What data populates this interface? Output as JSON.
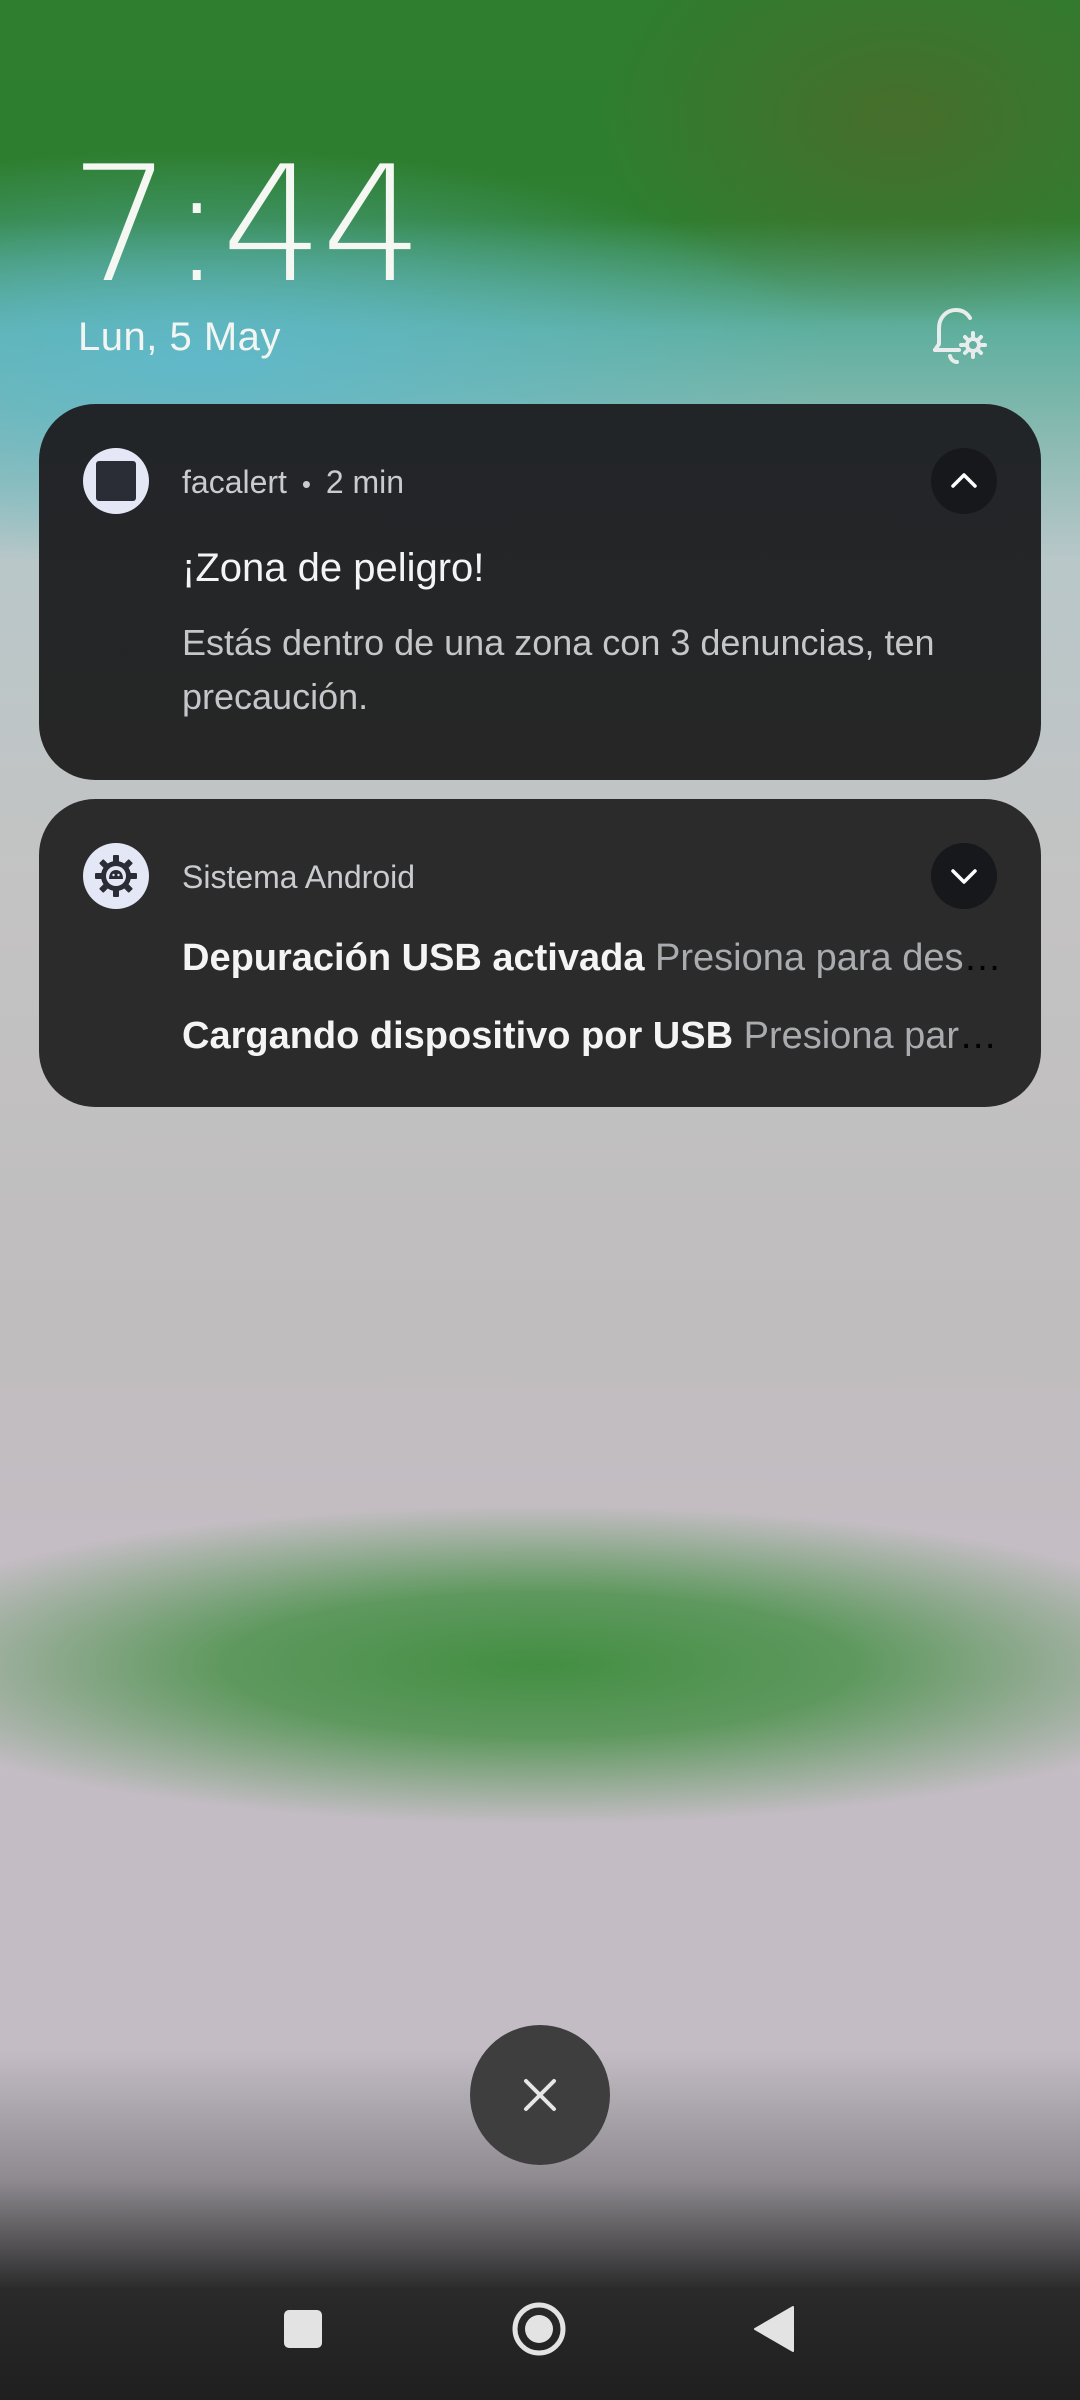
{
  "lockscreen": {
    "time": "7:44",
    "date": "Lun, 5 May"
  },
  "notifications": [
    {
      "app": "facalert",
      "separator": "•",
      "age": "2 min",
      "title": "¡Zona de peligro!",
      "body": "Estás dentro de una zona con 3 denuncias, ten precaución.",
      "expanded": true,
      "icon": "square-app-icon"
    },
    {
      "app": "Sistema Android",
      "expanded": false,
      "icon": "android-system-gear-icon",
      "rows": [
        {
          "title": "Depuración USB activada",
          "text": "Presiona para desactivar la depuración USB"
        },
        {
          "title": "Cargando dispositivo por USB",
          "text": "Presiona para ver más opciones"
        }
      ]
    }
  ],
  "icons": {
    "bell": "notification-settings-bell-icon",
    "dismiss": "close-icon",
    "nav": [
      "recents-square-icon",
      "home-circle-icon",
      "back-triangle-icon"
    ]
  },
  "colors": {
    "card_bg": "#262626",
    "text_primary": "#f4f4f4",
    "text_secondary": "#c4c6ca",
    "wallpaper_green": "#2e7f30"
  }
}
